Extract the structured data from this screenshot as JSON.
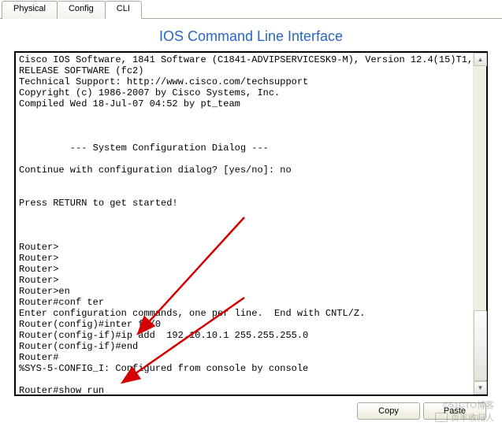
{
  "tabs": {
    "physical": "Physical",
    "config": "Config",
    "cli": "CLI"
  },
  "title": "IOS Command Line Interface",
  "terminal_text": "Cisco IOS Software, 1841 Software (C1841-ADVIPSERVICESK9-M), Version 12.4(15)T1,\nRELEASE SOFTWARE (fc2)\nTechnical Support: http://www.cisco.com/techsupport\nCopyright (c) 1986-2007 by Cisco Systems, Inc.\nCompiled Wed 18-Jul-07 04:52 by pt_team\n\n\n\n         --- System Configuration Dialog ---\n\nContinue with configuration dialog? [yes/no]: no\n\n\nPress RETURN to get started!\n\n\n\nRouter>\nRouter>\nRouter>\nRouter>\nRouter>en\nRouter#conf ter\nEnter configuration commands, one per line.  End with CNTL/Z.\nRouter(config)#inter f0/0\nRouter(config-if)#ip add  192.10.10.1 255.255.255.0\nRouter(config-if)#end\nRouter#\n%SYS-5-CONFIG_I: Configured from console by console\n\nRouter#show run",
  "buttons": {
    "copy": "Copy",
    "paste": "Paste"
  },
  "watermark": "页丰收归人",
  "watermark2": "©51CTO博客"
}
